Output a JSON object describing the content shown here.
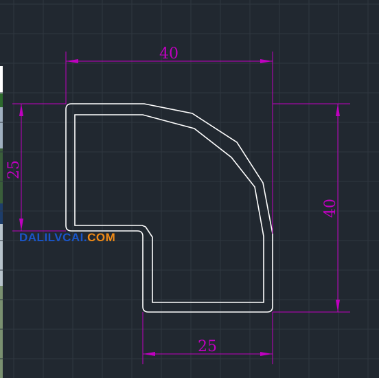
{
  "drawing": {
    "colors": {
      "background": "#212830",
      "grid": "#2f3740",
      "outline": "#ffffff",
      "dimension": "#c000c0",
      "watermark_blue": "#1a56c8",
      "watermark_orange": "#f08a16"
    },
    "dimensions": {
      "top_width": "40",
      "left_height": "25",
      "right_height": "40",
      "bottom_width": "25"
    }
  },
  "watermark": {
    "part1": "DALILVCAI.",
    "part2": "COM"
  }
}
